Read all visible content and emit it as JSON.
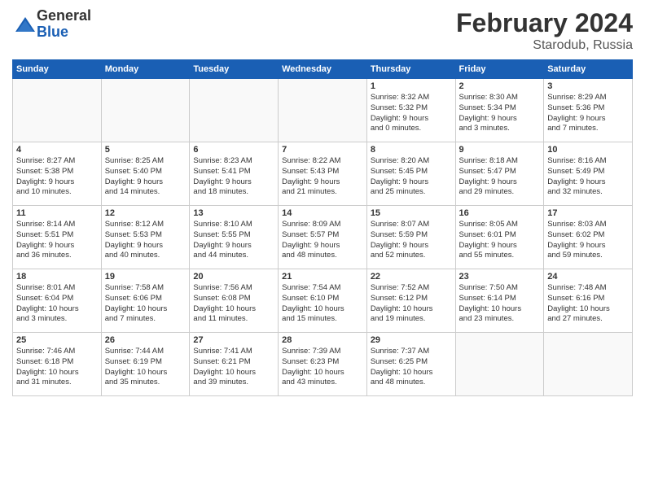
{
  "logo": {
    "text_general": "General",
    "text_blue": "Blue"
  },
  "title": {
    "month_year": "February 2024",
    "location": "Starodub, Russia"
  },
  "weekdays": [
    "Sunday",
    "Monday",
    "Tuesday",
    "Wednesday",
    "Thursday",
    "Friday",
    "Saturday"
  ],
  "weeks": [
    [
      {
        "day": "",
        "info": ""
      },
      {
        "day": "",
        "info": ""
      },
      {
        "day": "",
        "info": ""
      },
      {
        "day": "",
        "info": ""
      },
      {
        "day": "1",
        "info": "Sunrise: 8:32 AM\nSunset: 5:32 PM\nDaylight: 9 hours\nand 0 minutes."
      },
      {
        "day": "2",
        "info": "Sunrise: 8:30 AM\nSunset: 5:34 PM\nDaylight: 9 hours\nand 3 minutes."
      },
      {
        "day": "3",
        "info": "Sunrise: 8:29 AM\nSunset: 5:36 PM\nDaylight: 9 hours\nand 7 minutes."
      }
    ],
    [
      {
        "day": "4",
        "info": "Sunrise: 8:27 AM\nSunset: 5:38 PM\nDaylight: 9 hours\nand 10 minutes."
      },
      {
        "day": "5",
        "info": "Sunrise: 8:25 AM\nSunset: 5:40 PM\nDaylight: 9 hours\nand 14 minutes."
      },
      {
        "day": "6",
        "info": "Sunrise: 8:23 AM\nSunset: 5:41 PM\nDaylight: 9 hours\nand 18 minutes."
      },
      {
        "day": "7",
        "info": "Sunrise: 8:22 AM\nSunset: 5:43 PM\nDaylight: 9 hours\nand 21 minutes."
      },
      {
        "day": "8",
        "info": "Sunrise: 8:20 AM\nSunset: 5:45 PM\nDaylight: 9 hours\nand 25 minutes."
      },
      {
        "day": "9",
        "info": "Sunrise: 8:18 AM\nSunset: 5:47 PM\nDaylight: 9 hours\nand 29 minutes."
      },
      {
        "day": "10",
        "info": "Sunrise: 8:16 AM\nSunset: 5:49 PM\nDaylight: 9 hours\nand 32 minutes."
      }
    ],
    [
      {
        "day": "11",
        "info": "Sunrise: 8:14 AM\nSunset: 5:51 PM\nDaylight: 9 hours\nand 36 minutes."
      },
      {
        "day": "12",
        "info": "Sunrise: 8:12 AM\nSunset: 5:53 PM\nDaylight: 9 hours\nand 40 minutes."
      },
      {
        "day": "13",
        "info": "Sunrise: 8:10 AM\nSunset: 5:55 PM\nDaylight: 9 hours\nand 44 minutes."
      },
      {
        "day": "14",
        "info": "Sunrise: 8:09 AM\nSunset: 5:57 PM\nDaylight: 9 hours\nand 48 minutes."
      },
      {
        "day": "15",
        "info": "Sunrise: 8:07 AM\nSunset: 5:59 PM\nDaylight: 9 hours\nand 52 minutes."
      },
      {
        "day": "16",
        "info": "Sunrise: 8:05 AM\nSunset: 6:01 PM\nDaylight: 9 hours\nand 55 minutes."
      },
      {
        "day": "17",
        "info": "Sunrise: 8:03 AM\nSunset: 6:02 PM\nDaylight: 9 hours\nand 59 minutes."
      }
    ],
    [
      {
        "day": "18",
        "info": "Sunrise: 8:01 AM\nSunset: 6:04 PM\nDaylight: 10 hours\nand 3 minutes."
      },
      {
        "day": "19",
        "info": "Sunrise: 7:58 AM\nSunset: 6:06 PM\nDaylight: 10 hours\nand 7 minutes."
      },
      {
        "day": "20",
        "info": "Sunrise: 7:56 AM\nSunset: 6:08 PM\nDaylight: 10 hours\nand 11 minutes."
      },
      {
        "day": "21",
        "info": "Sunrise: 7:54 AM\nSunset: 6:10 PM\nDaylight: 10 hours\nand 15 minutes."
      },
      {
        "day": "22",
        "info": "Sunrise: 7:52 AM\nSunset: 6:12 PM\nDaylight: 10 hours\nand 19 minutes."
      },
      {
        "day": "23",
        "info": "Sunrise: 7:50 AM\nSunset: 6:14 PM\nDaylight: 10 hours\nand 23 minutes."
      },
      {
        "day": "24",
        "info": "Sunrise: 7:48 AM\nSunset: 6:16 PM\nDaylight: 10 hours\nand 27 minutes."
      }
    ],
    [
      {
        "day": "25",
        "info": "Sunrise: 7:46 AM\nSunset: 6:18 PM\nDaylight: 10 hours\nand 31 minutes."
      },
      {
        "day": "26",
        "info": "Sunrise: 7:44 AM\nSunset: 6:19 PM\nDaylight: 10 hours\nand 35 minutes."
      },
      {
        "day": "27",
        "info": "Sunrise: 7:41 AM\nSunset: 6:21 PM\nDaylight: 10 hours\nand 39 minutes."
      },
      {
        "day": "28",
        "info": "Sunrise: 7:39 AM\nSunset: 6:23 PM\nDaylight: 10 hours\nand 43 minutes."
      },
      {
        "day": "29",
        "info": "Sunrise: 7:37 AM\nSunset: 6:25 PM\nDaylight: 10 hours\nand 48 minutes."
      },
      {
        "day": "",
        "info": ""
      },
      {
        "day": "",
        "info": ""
      }
    ]
  ]
}
